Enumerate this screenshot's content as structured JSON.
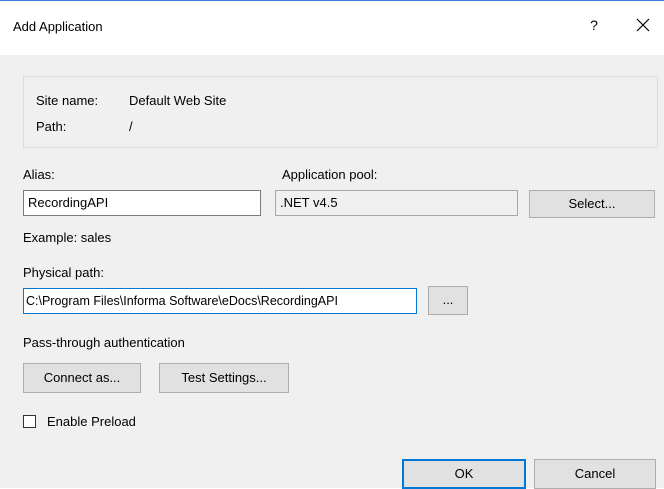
{
  "window": {
    "title": "Add Application",
    "help_label": "?"
  },
  "info": {
    "site_name_label": "Site name:",
    "site_name_value": "Default Web Site",
    "path_label": "Path:",
    "path_value": "/"
  },
  "alias": {
    "label": "Alias:",
    "value": "RecordingAPI",
    "example": "Example: sales"
  },
  "app_pool": {
    "label": "Application pool:",
    "value": ".NET v4.5",
    "select_label": "Select..."
  },
  "physical_path": {
    "label": "Physical path:",
    "value": "C:\\Program Files\\Informa Software\\eDocs\\RecordingAPI",
    "browse_label": "..."
  },
  "auth": {
    "label": "Pass-through authentication",
    "connect_as_label": "Connect as...",
    "test_settings_label": "Test Settings..."
  },
  "preload": {
    "label": "Enable Preload",
    "checked": false
  },
  "footer": {
    "ok_label": "OK",
    "cancel_label": "Cancel"
  }
}
